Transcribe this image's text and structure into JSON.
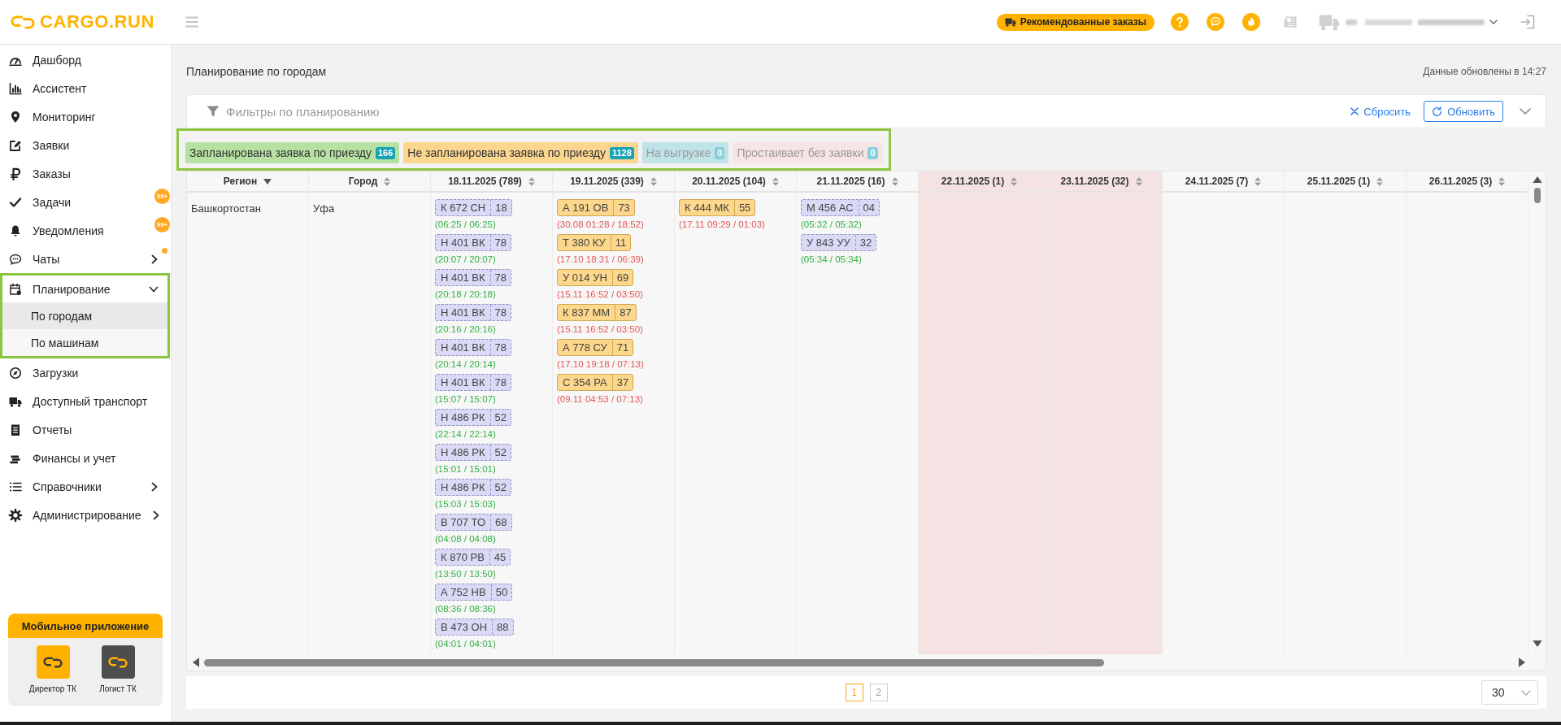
{
  "header": {
    "logo": "CARGO.RUN",
    "recommended_button": "Рекомендованные заказы"
  },
  "sidebar": {
    "items": [
      {
        "label": "Дашборд",
        "kind": "link",
        "selected": false,
        "dot": false,
        "highlighted": false
      },
      {
        "label": "Ассистент",
        "kind": "link",
        "selected": false,
        "dot": false,
        "highlighted": false
      },
      {
        "label": "Мониторинг",
        "kind": "link",
        "selected": false,
        "dot": false,
        "highlighted": false
      },
      {
        "label": "Заявки",
        "kind": "link",
        "selected": false,
        "dot": false,
        "highlighted": false
      },
      {
        "label": "Заказы",
        "kind": "link",
        "selected": false,
        "dot": false,
        "highlighted": false
      },
      {
        "label": "Задачи",
        "kind": "link",
        "selected": false,
        "dot": false,
        "highlighted": false,
        "badge": "99+"
      },
      {
        "label": "Уведомления",
        "kind": "link",
        "selected": false,
        "dot": false,
        "highlighted": false,
        "badge": "99+"
      },
      {
        "label": "Чаты",
        "kind": "group",
        "expanded": false,
        "selected": false,
        "dot": true,
        "highlighted": false
      },
      {
        "label": "Планирование",
        "kind": "group",
        "expanded": true,
        "selected": false,
        "dot": false,
        "highlighted": true,
        "children": [
          {
            "label": "По городам",
            "selected": true
          },
          {
            "label": "По машинам",
            "selected": false
          }
        ]
      },
      {
        "label": "Загрузки",
        "kind": "link",
        "selected": false,
        "dot": false,
        "highlighted": false
      },
      {
        "label": "Доступный транспорт",
        "kind": "link",
        "selected": false,
        "dot": false,
        "highlighted": false
      },
      {
        "label": "Отчеты",
        "kind": "link",
        "selected": false,
        "dot": false,
        "highlighted": false
      },
      {
        "label": "Финансы и учет",
        "kind": "link",
        "selected": false,
        "dot": false,
        "highlighted": false
      },
      {
        "label": "Справочники",
        "kind": "group",
        "expanded": false,
        "selected": false,
        "dot": false,
        "highlighted": false
      },
      {
        "label": "Администрирование",
        "kind": "group",
        "expanded": false,
        "selected": false,
        "dot": false,
        "highlighted": false
      }
    ]
  },
  "mobile_app": {
    "title": "Мобильное приложение",
    "apps": [
      {
        "label": "Директор ТК",
        "color": "#ffb300"
      },
      {
        "label": "Логист ТК",
        "color": "#4d4d4d"
      }
    ]
  },
  "page": {
    "title": "Планирование по городам",
    "updated": "Данные обновлены в 14:27"
  },
  "filters": {
    "title": "Фильтры по планированию",
    "reset_button": "Сбросить",
    "refresh_button": "Обновить",
    "expanded": false
  },
  "legend": {
    "highlighted": true,
    "items": [
      {
        "label": "Запланирована заявка по приезду",
        "count": "166",
        "color": "#b7e1a3",
        "disabled": false
      },
      {
        "label": "Не запланирована заявка по приезду",
        "count": "1128",
        "color": "#fbd68f",
        "disabled": false
      },
      {
        "label": "На выгрузке",
        "count": "0",
        "color": "#c0e3e8",
        "disabled": true
      },
      {
        "label": "Простаивает без заявки",
        "count": "0",
        "color": "#f7e4e4",
        "disabled": true
      }
    ]
  },
  "table": {
    "columns": [
      {
        "label": "Регион",
        "sorted": true,
        "highlighted": false
      },
      {
        "label": "Город",
        "sorted": false,
        "highlighted": false
      },
      {
        "label": "18.11.2025 (789)",
        "sorted": false,
        "highlighted": false
      },
      {
        "label": "19.11.2025 (339)",
        "sorted": false,
        "highlighted": false
      },
      {
        "label": "20.11.2025 (104)",
        "sorted": false,
        "highlighted": false
      },
      {
        "label": "21.11.2025 (16)",
        "sorted": false,
        "highlighted": false
      },
      {
        "label": "22.11.2025 (1)",
        "sorted": false,
        "highlighted": true
      },
      {
        "label": "23.11.2025 (32)",
        "sorted": false,
        "highlighted": true
      },
      {
        "label": "24.11.2025 (7)",
        "sorted": false,
        "highlighted": false
      },
      {
        "label": "25.11.2025 (1)",
        "sorted": false,
        "highlighted": false
      },
      {
        "label": "26.11.2025 (3)",
        "sorted": false,
        "highlighted": false
      }
    ],
    "rows": [
      {
        "region": "Башкортостан",
        "city": "Уфа",
        "days": [
          [
            {
              "plate": "К 672 СН",
              "region": "18",
              "time": "(06:25 / 06:25)",
              "kind": "planned"
            },
            {
              "plate": "Н 401 ВК",
              "region": "78",
              "time": "(20:07 / 20:07)",
              "kind": "planned"
            },
            {
              "plate": "Н 401 ВК",
              "region": "78",
              "time": "(20:18 / 20:18)",
              "kind": "planned"
            },
            {
              "plate": "Н 401 ВК",
              "region": "78",
              "time": "(20:16 / 20:16)",
              "kind": "planned"
            },
            {
              "plate": "Н 401 ВК",
              "region": "78",
              "time": "(20:14 / 20:14)",
              "kind": "planned"
            },
            {
              "plate": "Н 401 ВК",
              "region": "78",
              "time": "(15:07 / 15:07)",
              "kind": "planned"
            },
            {
              "plate": "Н 486 РК",
              "region": "52",
              "time": "(22:14 / 22:14)",
              "kind": "planned"
            },
            {
              "plate": "Н 486 РК",
              "region": "52",
              "time": "(15:01 / 15:01)",
              "kind": "planned"
            },
            {
              "plate": "Н 486 РК",
              "region": "52",
              "time": "(15:03 / 15:03)",
              "kind": "planned"
            },
            {
              "plate": "В 707 ТО",
              "region": "68",
              "time": "(04:08 / 04:08)",
              "kind": "planned"
            },
            {
              "plate": "К 870 РВ",
              "region": "45",
              "time": "(13:50 / 13:50)",
              "kind": "planned"
            },
            {
              "plate": "А 752 НВ",
              "region": "50",
              "time": "(08:36 / 08:36)",
              "kind": "planned"
            },
            {
              "plate": "В 473 ОН",
              "region": "88",
              "time": "(04:01 / 04:01)",
              "kind": "planned"
            }
          ],
          [
            {
              "plate": "А 191 ОВ",
              "region": "73",
              "time": "(30.08 01:28 / 18:52)",
              "kind": "unplanned"
            },
            {
              "plate": "Т 380 КУ",
              "region": "11",
              "time": "(17.10 18:31 / 06:39)",
              "kind": "unplanned"
            },
            {
              "plate": "У 014 УН",
              "region": "69",
              "time": "(15.11 16:52 / 03:50)",
              "kind": "unplanned"
            },
            {
              "plate": "К 837 ММ",
              "region": "87",
              "time": "(15.11 16:52 / 03:50)",
              "kind": "unplanned"
            },
            {
              "plate": "А 778 СУ",
              "region": "71",
              "time": "(17.10 19:18 / 07:13)",
              "kind": "unplanned"
            },
            {
              "plate": "С 354 РА",
              "region": "37",
              "time": "(09.11 04:53 / 07:13)",
              "kind": "unplanned"
            }
          ],
          [
            {
              "plate": "К 444 МК",
              "region": "55",
              "time": "(17.11 09:29 / 01:03)",
              "kind": "unplanned"
            }
          ],
          [
            {
              "plate": "М 456 АС",
              "region": "04",
              "time": "(05:32 / 05:32)",
              "kind": "planned"
            },
            {
              "plate": "У 843 УУ",
              "region": "32",
              "time": "(05:34 / 05:34)",
              "kind": "planned"
            }
          ]
        ]
      }
    ]
  },
  "pagination": {
    "pages": [
      {
        "label": "1",
        "selected": true
      },
      {
        "label": "2",
        "selected": false
      }
    ],
    "page_size": "30"
  }
}
